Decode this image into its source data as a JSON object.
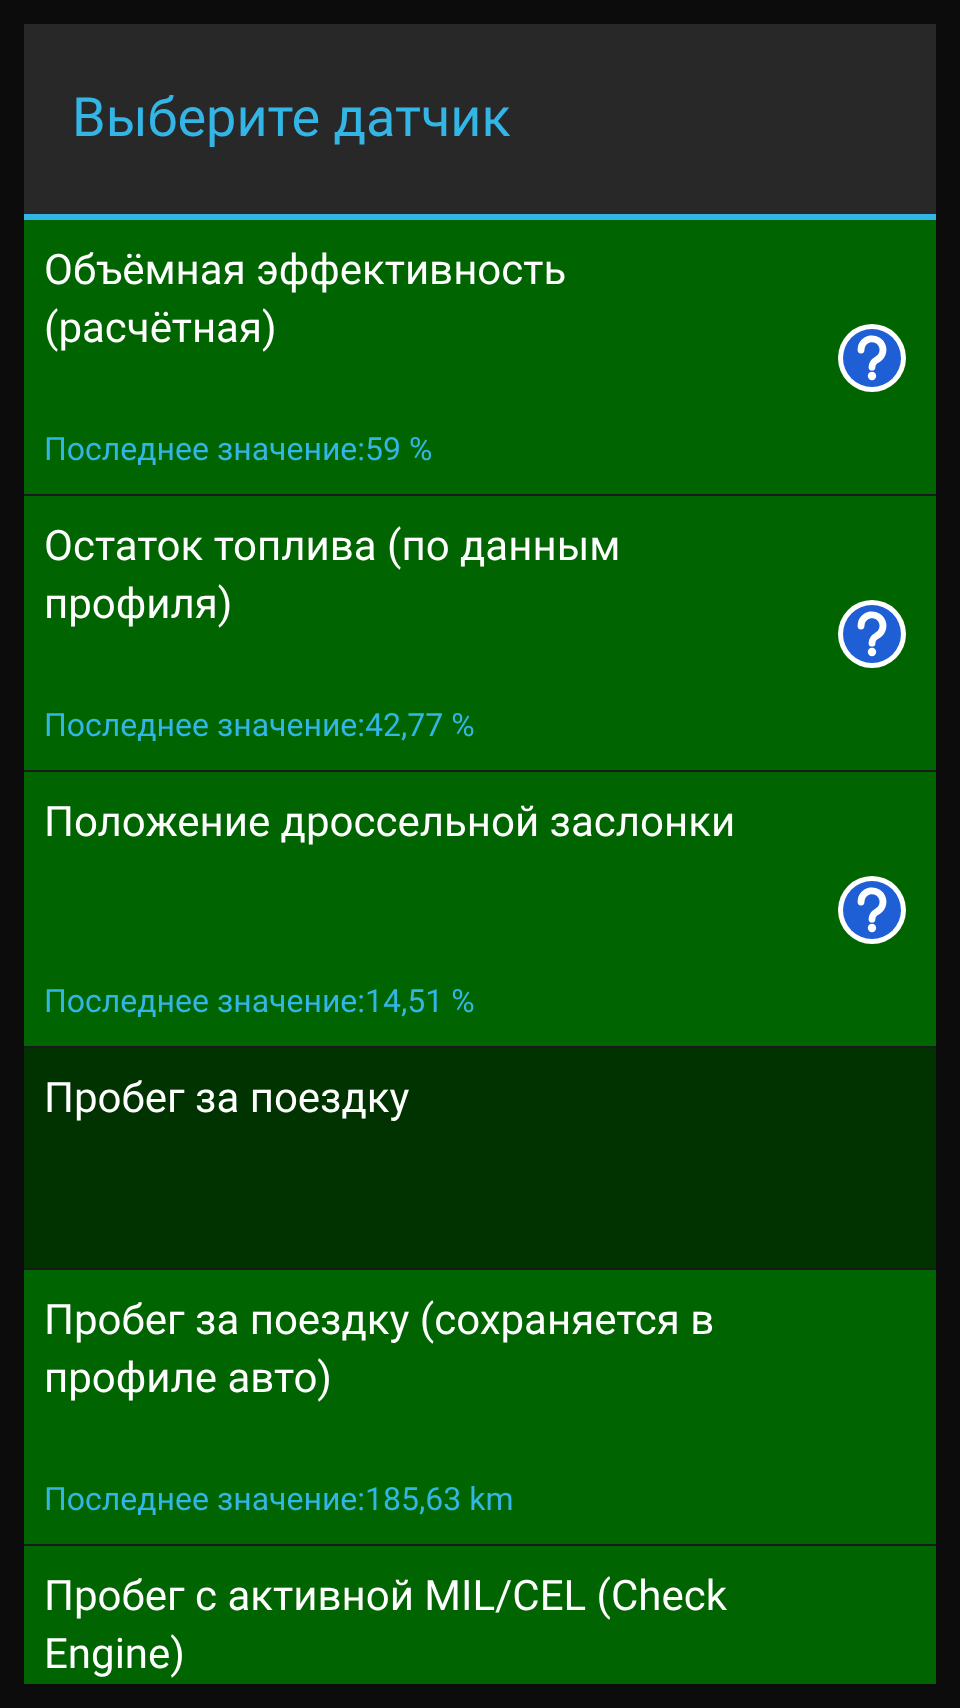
{
  "dialog": {
    "title": "Выберите датчик"
  },
  "sensors": [
    {
      "title": "Объёмная эффективность (расчётная)",
      "value": "Последнее значение:59 %",
      "help": true,
      "selected": false
    },
    {
      "title": "Остаток топлива (по данным профиля)",
      "value": "Последнее значение:42,77 %",
      "help": true,
      "selected": false
    },
    {
      "title": "Положение дроссельной заслонки",
      "value": "Последнее значение:14,51 %",
      "help": true,
      "selected": false
    },
    {
      "title": "Пробег за поездку",
      "help": false,
      "selected": true
    },
    {
      "title": "Пробег за поездку (сохраняется в профиле авто)",
      "value": "Последнее значение:185,63 km",
      "help": false,
      "selected": false
    },
    {
      "title": "Пробег с активной MIL/CEL (Check Engine)",
      "help": false,
      "selected": false
    }
  ]
}
